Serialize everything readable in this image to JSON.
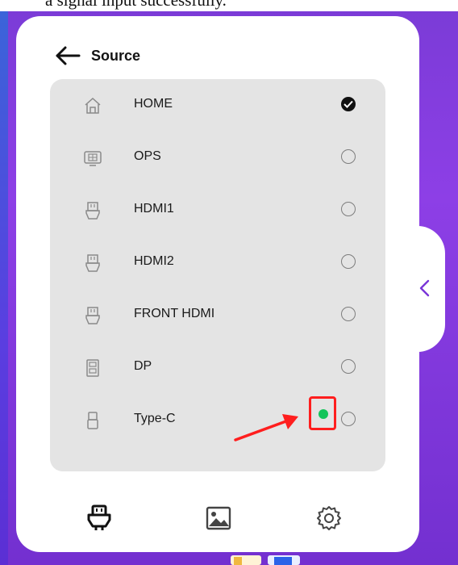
{
  "caption_fragment": "a signal input successfully.",
  "header": {
    "back_label": "back",
    "title": "Source"
  },
  "sources": [
    {
      "label": "HOME",
      "icon": "home-icon",
      "selected": true
    },
    {
      "label": "OPS",
      "icon": "ops-icon",
      "selected": false
    },
    {
      "label": "HDMI1",
      "icon": "hdmi-icon",
      "selected": false
    },
    {
      "label": "HDMI2",
      "icon": "hdmi-icon",
      "selected": false
    },
    {
      "label": "FRONT HDMI",
      "icon": "hdmi-icon",
      "selected": false
    },
    {
      "label": "DP",
      "icon": "dp-icon",
      "selected": false
    },
    {
      "label": "Type-C",
      "icon": "type-c-icon",
      "selected": false,
      "signal_detected": true
    }
  ],
  "bottom_nav": [
    {
      "name": "source",
      "icon": "source-plug-icon"
    },
    {
      "name": "display",
      "icon": "image-icon"
    },
    {
      "name": "settings",
      "icon": "gear-icon"
    }
  ],
  "colors": {
    "background": "#8d3fe6",
    "panel": "#ffffff",
    "list_background": "#e4e4e4",
    "signal_indicator": "#13c45a",
    "annotation_red": "#ff1e1e",
    "side_chevron": "#7a35d8"
  }
}
